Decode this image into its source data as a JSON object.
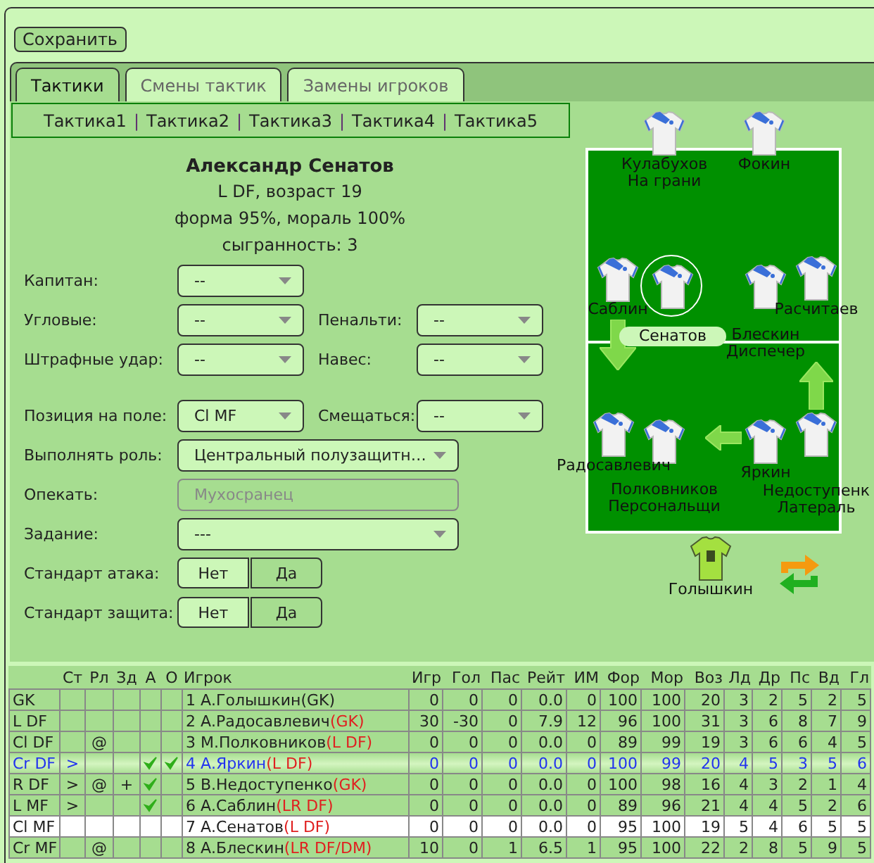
{
  "save_button": "Сохранить",
  "tabs": [
    {
      "label": "Тактики",
      "selected": true
    },
    {
      "label": "Смены тактик",
      "selected": false
    },
    {
      "label": "Замены игроков",
      "selected": false
    }
  ],
  "tactic_links": [
    {
      "label": "Тактика1",
      "separator": "|"
    },
    {
      "label": "Тактика2",
      "separator": "|"
    },
    {
      "label": "Тактика3",
      "separator": "|"
    },
    {
      "label": "Тактика4",
      "separator": "|"
    },
    {
      "label": "Тактика5"
    }
  ],
  "player_card": {
    "name": "Александр Сенатов",
    "lines": [
      "L DF, возраст 19",
      "форма 95%, мораль 100%",
      "сыгранность: 3"
    ]
  },
  "settings": [
    {
      "items": [
        {
          "kind": "select",
          "label": "Капитан:",
          "value": "--",
          "disabled": false
        }
      ]
    },
    {
      "items": [
        {
          "kind": "select",
          "label": "Угловые:",
          "value": "--",
          "disabled": false
        },
        {
          "kind": "select",
          "label": "Пенальти:",
          "value": "--",
          "disabled": false
        }
      ]
    },
    {
      "items": [
        {
          "kind": "select",
          "label": "Штрафные удар:",
          "value": "--",
          "disabled": false
        },
        {
          "kind": "select",
          "label": "Навес:",
          "value": "--",
          "disabled": false
        }
      ]
    },
    {
      "items": [
        {
          "kind": "select",
          "label": "Позиция на поле:",
          "value": "Cl MF",
          "disabled": false
        },
        {
          "kind": "select",
          "label": "Смещаться:",
          "value": "--",
          "disabled": false
        }
      ]
    },
    {
      "items": [
        {
          "kind": "wide_select",
          "label": "Выполнять роль:",
          "value": "Центральный полузащитн…",
          "disabled": false
        }
      ]
    },
    {
      "items": [
        {
          "kind": "field",
          "label": "Опекать:",
          "value": "Мухосранец",
          "disabled": true
        }
      ]
    },
    {
      "items": [
        {
          "kind": "wide_select",
          "label": "Задание:",
          "value": "---",
          "disabled": false
        }
      ]
    },
    {
      "items": [
        {
          "kind": "toggle",
          "label": "Стандарт атака:",
          "options": [
            {
              "label": "Нет",
              "selected": false
            },
            {
              "label": "Да",
              "selected": true
            }
          ]
        }
      ]
    },
    {
      "items": [
        {
          "kind": "toggle",
          "label": "Стандарт защита:",
          "options": [
            {
              "label": "Нет",
              "selected": false
            },
            {
              "label": "Да",
              "selected": true
            }
          ]
        }
      ]
    }
  ],
  "pitch": {
    "players": [
      {
        "name": "Кулабухов",
        "role": "На грани",
        "kind": "outfield",
        "selected": false
      },
      {
        "name": "Фокин",
        "kind": "outfield",
        "selected": false
      },
      {
        "name": "Саблин",
        "kind": "outfield",
        "selected": false
      },
      {
        "name": "Сенатов",
        "kind": "outfield",
        "selected": true
      },
      {
        "name": "Блескин",
        "role": "Диспечер",
        "kind": "outfield",
        "selected": false
      },
      {
        "name": "Расчитаев",
        "kind": "outfield",
        "selected": false
      },
      {
        "name": "Радосавлевич",
        "kind": "outfield",
        "selected": false
      },
      {
        "name": "Полковников",
        "role": "Персональщи",
        "kind": "outfield",
        "selected": false
      },
      {
        "name": "Яркин",
        "kind": "outfield",
        "selected": false
      },
      {
        "name": "Недоступенк",
        "role": "Латераль",
        "kind": "outfield",
        "selected": false
      },
      {
        "name": "Голышкин",
        "kind": "goalkeeper",
        "selected": false
      }
    ],
    "shift_arrows": [
      {
        "kind": "down"
      },
      {
        "kind": "left"
      },
      {
        "kind": "up"
      }
    ]
  },
  "table": {
    "columns": [
      "Ст",
      "Рл",
      "Зд",
      "А",
      "О",
      "Игрок",
      "Игр",
      "Гол",
      "Пас",
      "Рейт",
      "ИМ",
      "Фор",
      "Мор",
      "Воз",
      "Лд",
      "Др",
      "Пс",
      "Вд",
      "Гл"
    ],
    "rows": [
      {
        "position": "GK",
        "a": false,
        "o": false,
        "player": "1 А.Голышкин",
        "natural": "(GK)",
        "natural_ok": true,
        "stats": [
          "0",
          "0",
          "0",
          "0.0",
          "0",
          "100",
          "100",
          "20",
          "3",
          "2",
          "5",
          "2",
          "5"
        ],
        "selected": false,
        "highlighted": false
      },
      {
        "position": "L DF",
        "a": false,
        "o": false,
        "player": "2 А.Радосавлевич",
        "natural": "(GK)",
        "natural_ok": false,
        "stats": [
          "30",
          "-30",
          "0",
          "7.9",
          "12",
          "96",
          "100",
          "31",
          "3",
          "6",
          "8",
          "7",
          "9"
        ],
        "selected": false,
        "highlighted": false
      },
      {
        "position": "Cl DF",
        "rl": "@",
        "a": false,
        "o": false,
        "player": "3 М.Полковников",
        "natural": "(L DF)",
        "natural_ok": false,
        "stats": [
          "0",
          "0",
          "0",
          "0.0",
          "0",
          "89",
          "99",
          "19",
          "3",
          "6",
          "6",
          "4",
          "5"
        ],
        "selected": false,
        "highlighted": false
      },
      {
        "position": "Cr DF",
        "st": ">",
        "a": true,
        "o": true,
        "player": "4 А.Яркин",
        "natural": "(L DF)",
        "natural_ok": false,
        "stats": [
          "0",
          "0",
          "0",
          "0.0",
          "0",
          "100",
          "99",
          "20",
          "4",
          "5",
          "3",
          "5",
          "6"
        ],
        "selected": false,
        "highlighted": true
      },
      {
        "position": "R DF",
        "st": ">",
        "rl": "@",
        "zd": "+",
        "a": true,
        "o": false,
        "player": "5 В.Недоступенко",
        "natural": "(GK)",
        "natural_ok": false,
        "stats": [
          "0",
          "0",
          "0",
          "0.0",
          "0",
          "100",
          "98",
          "16",
          "4",
          "3",
          "2",
          "1",
          "4"
        ],
        "selected": false,
        "highlighted": false
      },
      {
        "position": "L MF",
        "st": ">",
        "a": true,
        "o": false,
        "player": "6 А.Саблин",
        "natural": "(LR DF)",
        "natural_ok": false,
        "stats": [
          "0",
          "0",
          "0",
          "0.0",
          "0",
          "89",
          "96",
          "21",
          "4",
          "4",
          "5",
          "2",
          "6"
        ],
        "selected": false,
        "highlighted": false
      },
      {
        "position": "Cl MF",
        "a": false,
        "o": false,
        "player": "7 А.Сенатов",
        "natural": "(L DF)",
        "natural_ok": false,
        "stats": [
          "0",
          "0",
          "0",
          "0.0",
          "0",
          "95",
          "100",
          "19",
          "5",
          "4",
          "6",
          "5",
          "5"
        ],
        "selected": true,
        "highlighted": false
      },
      {
        "position": "Cr MF",
        "rl": "@",
        "a": false,
        "o": false,
        "player": "8 А.Блескин",
        "natural": "(LR DF/DM)",
        "natural_ok": false,
        "stats": [
          "10",
          "0",
          "1",
          "6.5",
          "1",
          "95",
          "100",
          "22",
          "2",
          "8",
          "5",
          "9",
          "5"
        ],
        "selected": false,
        "highlighted": false
      }
    ]
  }
}
